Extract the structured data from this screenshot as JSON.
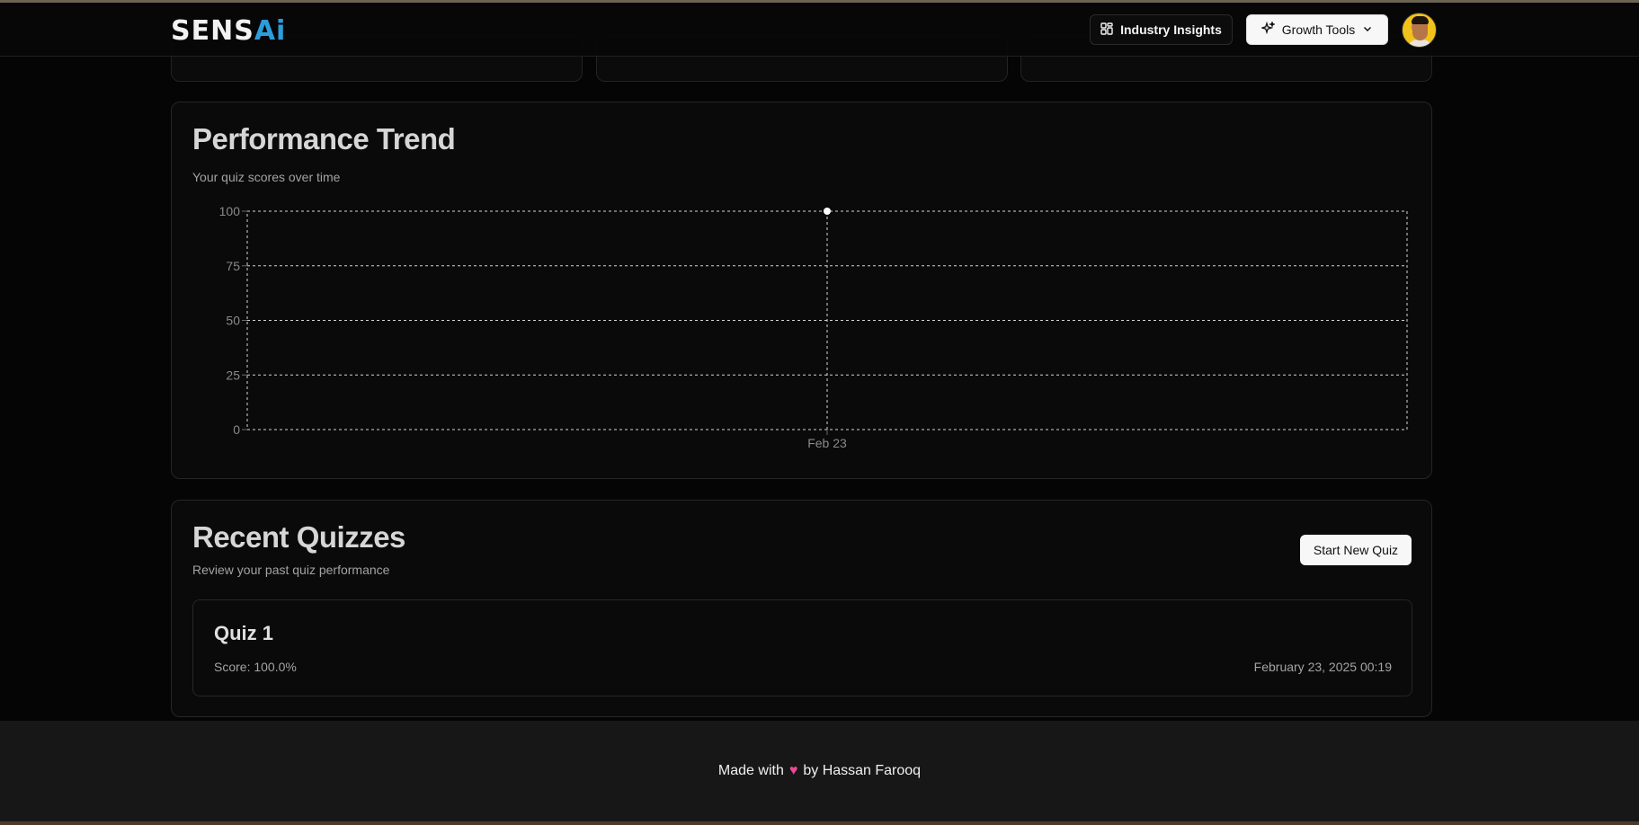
{
  "header": {
    "logo_main": "SENS",
    "logo_accent": "Ai",
    "insights_label": "Industry Insights",
    "growth_label": "Growth Tools"
  },
  "performance": {
    "title": "Performance Trend",
    "subtitle": "Your quiz scores over time"
  },
  "chart_data": {
    "type": "line",
    "title": "Performance Trend",
    "subtitle": "Your quiz scores over time",
    "x": [
      "Feb 23"
    ],
    "series": [
      {
        "values": [
          100
        ]
      }
    ],
    "ylim": [
      0,
      100
    ],
    "yticks": [
      0,
      25,
      50,
      75,
      100
    ],
    "grid": true,
    "point_color": "#ffffff",
    "grid_color": "#d4d4d4"
  },
  "recent": {
    "title": "Recent Quizzes",
    "subtitle": "Review your past quiz performance",
    "new_quiz_label": "Start New Quiz",
    "quizzes": [
      {
        "title": "Quiz 1",
        "score": "Score: 100.0%",
        "date": "February 23, 2025 00:19"
      }
    ]
  },
  "footer": {
    "prefix": "Made with",
    "suffix": "by Hassan Farooq"
  },
  "colors": {
    "background": "#050505",
    "accent": "#2d9cdb",
    "heart": "#ec4899"
  },
  "icons": {
    "insights": "layout-dashboard-icon",
    "growth": "stars-icon",
    "chevron": "chevron-down-icon"
  }
}
